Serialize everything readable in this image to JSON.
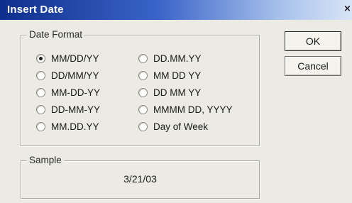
{
  "window": {
    "title": "Insert Date",
    "close_glyph": "×"
  },
  "date_format": {
    "label": "Date Format",
    "selected": "MM/DD/YY",
    "options_left": [
      "MM/DD/YY",
      "DD/MM/YY",
      "MM-DD-YY",
      "DD-MM-YY",
      "MM.DD.YY"
    ],
    "options_right": [
      "DD.MM.YY",
      "MM DD YY",
      "DD MM YY",
      "MMMM DD, YYYY",
      "Day of Week"
    ]
  },
  "sample": {
    "label": "Sample",
    "value": "3/21/03"
  },
  "buttons": {
    "ok": "OK",
    "cancel": "Cancel"
  }
}
